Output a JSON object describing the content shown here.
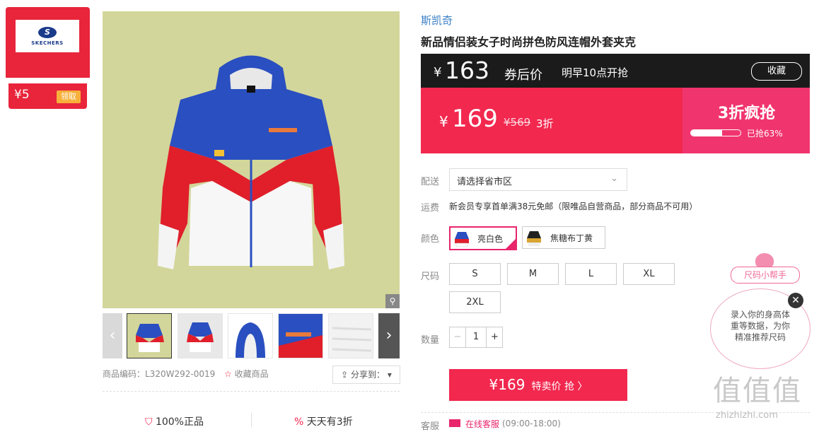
{
  "coupon": {
    "logo_letter": "S",
    "logo_text": "SKECHERS",
    "amount": "¥5",
    "get_label": "领取"
  },
  "gallery": {
    "zoom_icon": "magnifier-icon"
  },
  "product_meta": {
    "code_label": "商品编码：L320W292-0019",
    "fav_label": "收藏商品",
    "share_label": "分享到："
  },
  "guarantees": [
    {
      "label": "100%正品"
    },
    {
      "label": "天天有3折"
    }
  ],
  "brand": "斯凯奇",
  "title": "新品情侣装女子时尚拼色防风连帽外套夹克",
  "coupon_price": {
    "symbol": "¥",
    "value": "163",
    "suffix": "券后价",
    "start": "明早10点开抢",
    "collect_label": "收藏"
  },
  "price": {
    "symbol": "¥",
    "value": "169",
    "original": "¥569",
    "discount": "3折",
    "promo_title": "3折疯抢",
    "sold_text": "已抢63%",
    "sold_pct": 63
  },
  "delivery": {
    "label": "配送",
    "placeholder": "请选择省市区"
  },
  "shipping": {
    "label": "运费",
    "text": "新会员专享首单满38元免邮（限唯品自营商品，部分商品不可用）"
  },
  "colors": {
    "label": "颜色",
    "options": [
      {
        "name": "亮白色",
        "selected": true
      },
      {
        "name": "焦糖布丁黄",
        "selected": false
      }
    ]
  },
  "sizes": {
    "label": "尺码",
    "options": [
      "S",
      "M",
      "L",
      "XL",
      "2XL"
    ]
  },
  "quantity": {
    "label": "数量",
    "value": "1",
    "minus": "−",
    "plus": "+"
  },
  "buy_button": {
    "price": "¥169",
    "label": "特卖价 抢 〉"
  },
  "service": {
    "label": "客服",
    "link": "在线客服",
    "hours": "(09:00-18:00)"
  },
  "size_helper": {
    "tag": "尺码小帮手",
    "text": "录入你的身高体重等数据，为你精准推荐尺码"
  },
  "watermark": {
    "logo": "值值值",
    "site": "zhizhizhi.com"
  }
}
